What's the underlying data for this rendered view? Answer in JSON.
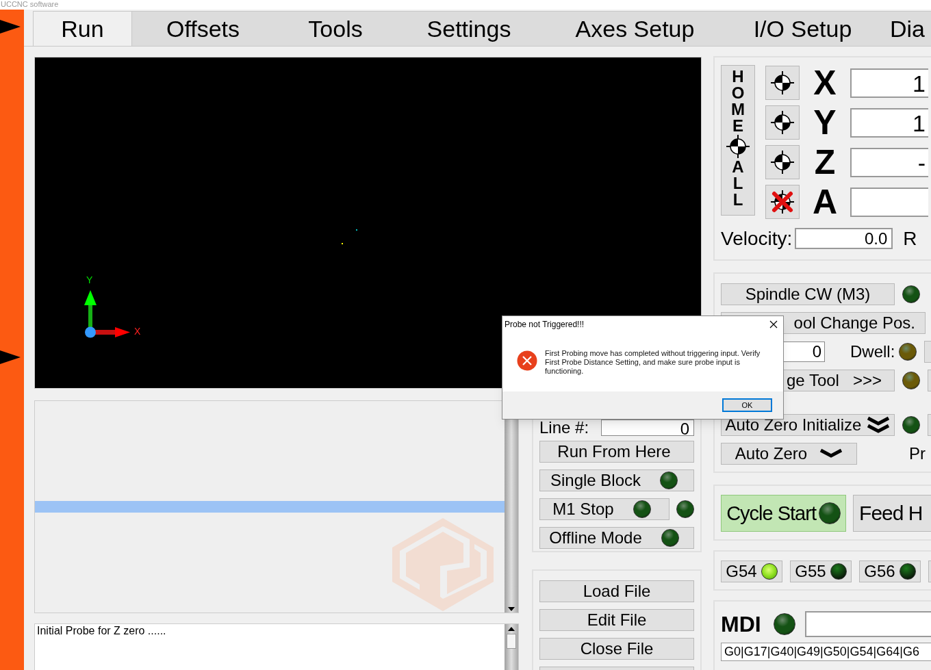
{
  "window": {
    "title": "UCCNC software"
  },
  "tabs": [
    {
      "label": "Run",
      "selected": true
    },
    {
      "label": "Offsets",
      "selected": false
    },
    {
      "label": "Tools",
      "selected": false
    },
    {
      "label": "Settings",
      "selected": false
    },
    {
      "label": "Axes Setup",
      "selected": false
    },
    {
      "label": "I/O Setup",
      "selected": false
    },
    {
      "label": "Dia",
      "selected": false
    }
  ],
  "viewport": {
    "axis_labels": {
      "x": "X",
      "y": "Y"
    }
  },
  "gcode_view": {
    "current_line_highlight": true
  },
  "status_box": {
    "text": "Initial Probe for Z zero ......"
  },
  "program_controls": {
    "line_label": "Line #:",
    "line_value": "0",
    "buttons": [
      {
        "label": "Run From Here"
      },
      {
        "label": "Single Block",
        "led": {
          "on": false,
          "color": "#145214"
        }
      },
      {
        "label": "M1 Stop",
        "led": {
          "on": false,
          "color": "#145214"
        },
        "side_led": {
          "on": false,
          "color": "#145214"
        }
      },
      {
        "label": "Offline Mode",
        "led": {
          "on": false,
          "color": "#145214"
        }
      }
    ]
  },
  "file_buttons": [
    "Load File",
    "Edit File",
    "Close File"
  ],
  "dro": {
    "home_all": {
      "top": "HOME",
      "bottom": "ALL"
    },
    "axes": [
      {
        "letter": "X",
        "value": "1",
        "enabled": true
      },
      {
        "letter": "Y",
        "value": "1",
        "enabled": true
      },
      {
        "letter": "Z",
        "value": "-",
        "enabled": true
      },
      {
        "letter": "A",
        "enabled": false
      }
    ],
    "velocity_label": "Velocity:",
    "velocity_value": "0.0",
    "rpm_label": "R"
  },
  "tool_rows": [
    {
      "kind": "led",
      "label": "Spindle CW (M3)",
      "led": {
        "on": false,
        "color": "#145214"
      }
    },
    {
      "kind": "wide",
      "label": "ool Change Pos."
    },
    {
      "kind": "dwell",
      "field_value": "0",
      "label": "Dwell:",
      "led": {
        "on": false,
        "color": "#6b5a08"
      }
    },
    {
      "kind": "led_right",
      "label": "ge Tool   >>>",
      "led": {
        "on": false,
        "color": "#6b5a08"
      },
      "partial": true
    }
  ],
  "probe_rows": [
    {
      "kind": "led_double_chevron",
      "label": "Auto Zero Initialize",
      "led": {
        "on": false,
        "color": "#145214"
      },
      "partial": true
    },
    {
      "kind": "short_chevron",
      "label": "Auto Zero",
      "side_text": "Pr"
    }
  ],
  "cycle": {
    "start_label": "Cycle Start",
    "start_led": {
      "on": false,
      "color": "#145214"
    },
    "feed_hold_label": "Feed H"
  },
  "work_offsets": [
    {
      "label": "G54",
      "selected": true
    },
    {
      "label": "G55",
      "selected": false
    },
    {
      "label": "G56",
      "selected": false
    }
  ],
  "mdi": {
    "label": "MDI",
    "led": {
      "on": false,
      "color": "#145214"
    },
    "modal_codes": "G0|G17|G40|G49|G50|G54|G64|G6"
  },
  "dialog": {
    "title": "Probe not Triggered!!!",
    "message": "First Probing move has completed without triggering input. Verify First Probe Distance Setting, and make sure probe input is functioning.",
    "button": "OK"
  }
}
